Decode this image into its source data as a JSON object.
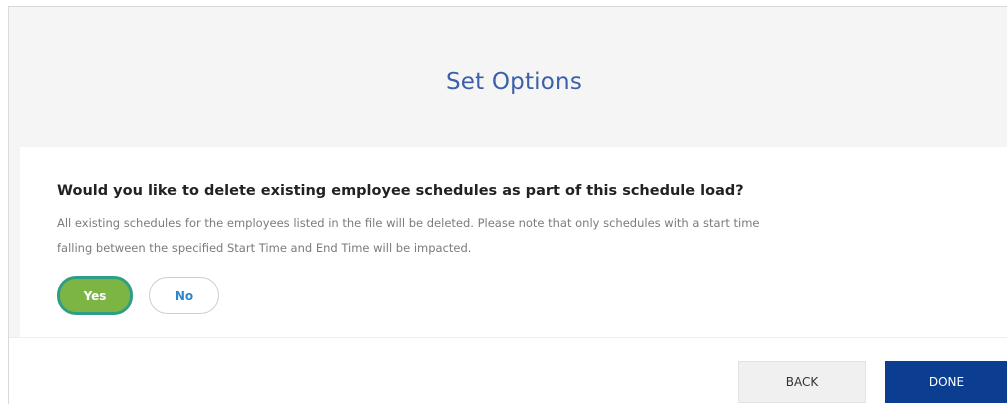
{
  "header": {
    "title": "Set Options"
  },
  "card": {
    "question": "Would you like to delete existing employee schedules as part of this schedule load?",
    "description_line1": "All existing schedules for the employees listed in the file will be deleted. Please note that only schedules with a start time",
    "description_line2": "falling between the specified Start Time and End Time will be impacted.",
    "options": {
      "yes_label": "Yes",
      "no_label": "No",
      "selected": "Yes"
    }
  },
  "footer": {
    "back_label": "BACK",
    "done_label": "DONE"
  },
  "colors": {
    "title": "#3b5fa8",
    "yes_fill": "#7cb544",
    "yes_border": "#2e9e87",
    "no_text": "#2f86c9",
    "done_fill": "#0b3d91"
  }
}
